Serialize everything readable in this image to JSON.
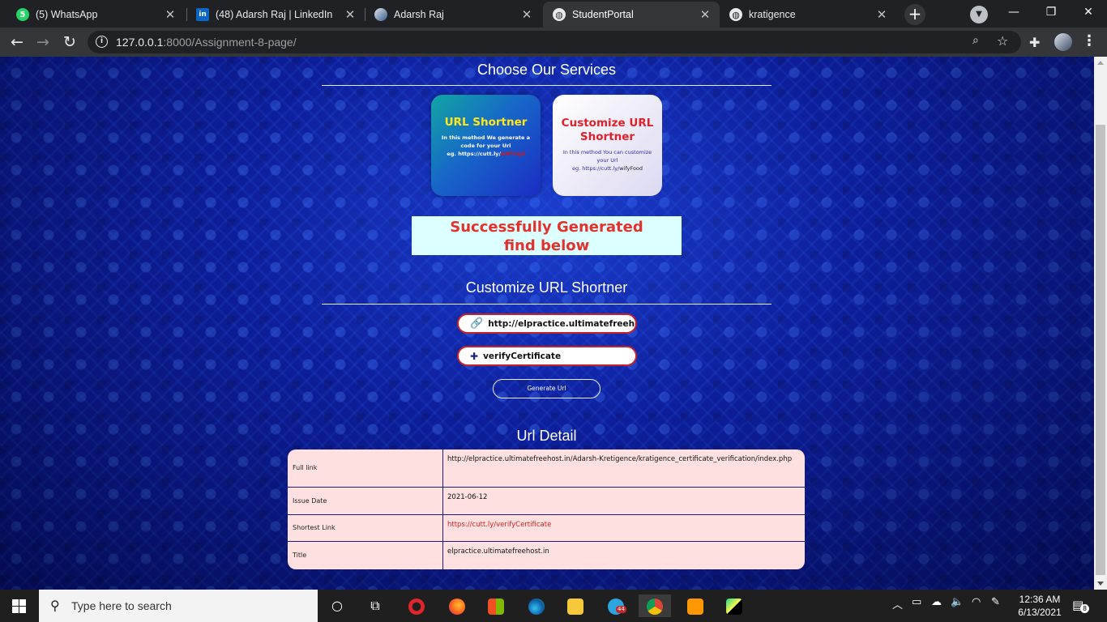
{
  "browser": {
    "tabs": [
      {
        "title": "(5) WhatsApp",
        "favicon": "whatsapp-icon",
        "color": "#25d366",
        "glyph": "5"
      },
      {
        "title": "(48) Adarsh Raj | LinkedIn",
        "favicon": "linkedin-icon",
        "color": "#0a66c2",
        "glyph": "in"
      },
      {
        "title": "Adarsh Raj",
        "favicon": "profile-avatar-icon",
        "color": "#5b7fb5",
        "glyph": ""
      },
      {
        "title": "StudentPortal",
        "favicon": "globe-icon",
        "color": "#e8eaed",
        "glyph": ""
      },
      {
        "title": "kratigence",
        "favicon": "globe-icon",
        "color": "#e8eaed",
        "glyph": ""
      }
    ],
    "active_tab_index": 3,
    "url_host": "127.0.0.1",
    "url_rest": ":8000/Assignment-8-page/"
  },
  "page": {
    "services_title": "Choose Our Services",
    "cards": [
      {
        "title": "URL Shortner",
        "desc": "In this method We generate a code for your Url",
        "example_prefix": "eg. https://cutt.ly/",
        "example_code": "w9Ft1Jd"
      },
      {
        "title": "Customize URL Shortner",
        "desc": "In this method You can customize your Url",
        "example_prefix": "eg. https://cutt.ly/",
        "example_code": "wifyFood"
      }
    ],
    "success_line1": "Successfully Generated",
    "success_line2": "find below",
    "form_title": "Customize URL Shortner",
    "url_field_value": "http://elpractice.ultimatefreehost.in/Adarsh-Kretigence/kratigence_certificate_verification/index.php",
    "alias_field_value": "verifyCertificate",
    "generate_button": "Generate Url",
    "detail_title": "Url Detail",
    "detail_rows": [
      {
        "label": "Full link",
        "value": "http://elpractice.ultimatefreehost.in/Adarsh-Kretigence/kratigence_certificate_verification/index.php"
      },
      {
        "label": "Issue Date",
        "value": "2021-06-12"
      },
      {
        "label": "Shortest Link",
        "value": "https://cutt.ly/verifyCertificate"
      },
      {
        "label": "Title",
        "value": "elpractice.ultimatefreehost.in"
      }
    ]
  },
  "taskbar": {
    "search_placeholder": "Type here to search",
    "time": "12:36 AM",
    "date": "6/13/2021",
    "notification_count": "8",
    "telegram_badge": "44",
    "apps": [
      "task-view-icon",
      "opera-icon",
      "firefox-icon",
      "store-icon",
      "edge-icon",
      "file-explorer-icon",
      "telegram-icon",
      "chrome-icon",
      "sublime-text-icon",
      "pycharm-icon"
    ]
  },
  "colors": {
    "page_bg": "#0b1b8c",
    "success_bg": "#dcffff",
    "success_text": "#e3312d",
    "detail_bg": "#ffe0e0",
    "field_border": "#c8202a"
  }
}
